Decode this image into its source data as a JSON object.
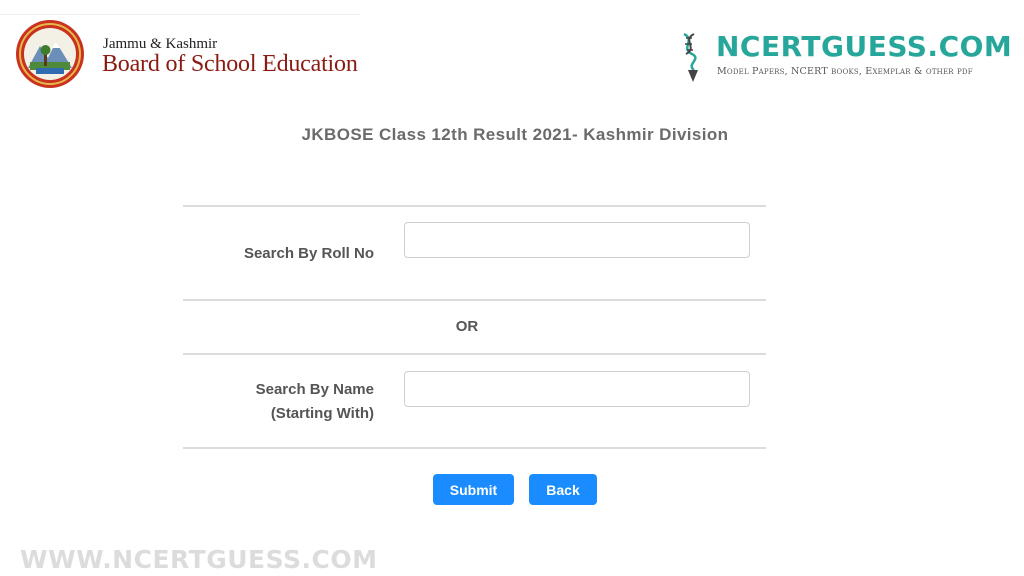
{
  "header": {
    "board_line1": "Jammu & Kashmir",
    "board_line2": "Board of School Education",
    "brand_name": "NCERTGUESS.COM",
    "brand_tagline": "Model Papers, NCERT books, Exemplar & other pdf"
  },
  "form": {
    "title": "JKBOSE Class 12th Result 2021- Kashmir Division",
    "roll_label": "Search By Roll No",
    "roll_value": "",
    "or_text": "OR",
    "name_label_line1": "Search By Name",
    "name_label_line2": "(Starting With)",
    "name_value": "",
    "submit_label": "Submit",
    "back_label": "Back"
  },
  "watermark": "WWW.NCERTGUESS.COM",
  "colors": {
    "brand_teal": "#27a79b",
    "board_red": "#8b1a12",
    "button_blue": "#1a8cff"
  },
  "icons": {
    "board_logo": "jkbose-emblem-icon",
    "brand_logo": "dna-pencil-icon"
  }
}
